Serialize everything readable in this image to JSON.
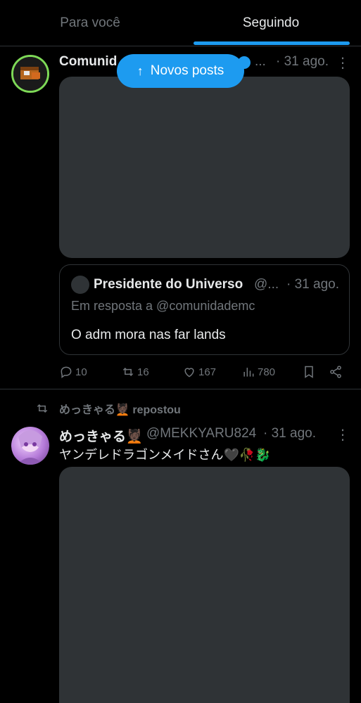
{
  "tabs": [
    {
      "label": "Para você",
      "selected": false
    },
    {
      "label": "Seguindo",
      "selected": true
    }
  ],
  "new_posts_button": {
    "icon": "arrow-up-icon",
    "label": "Novos posts"
  },
  "post1": {
    "author_name": "Comunid",
    "author_ellipsis": "...",
    "time": "· 31 ago.",
    "quote": {
      "author_name": "Presidente do Universo",
      "handle": "@...",
      "time": "· 31 ago.",
      "reply_to": "Em resposta a @comunidademc",
      "text": "O adm mora nas far lands"
    },
    "stats": {
      "replies": "10",
      "reposts": "16",
      "likes": "167",
      "views": "780"
    }
  },
  "post2": {
    "reposted_by": "めっきゃる💆🏿 repostou",
    "author_name": "めっきゃる💆🏿",
    "handle": "@MEKKYARU824",
    "time": "· 31 ago.",
    "text": "ヤンデレドラゴンメイドさん🖤🥀🐉"
  },
  "colors": {
    "accent": "#1d9bf0",
    "muted": "#71767b",
    "text": "#e7e9ea",
    "media_placeholder": "#2f3336",
    "avatar_ring": "#7ed957"
  }
}
